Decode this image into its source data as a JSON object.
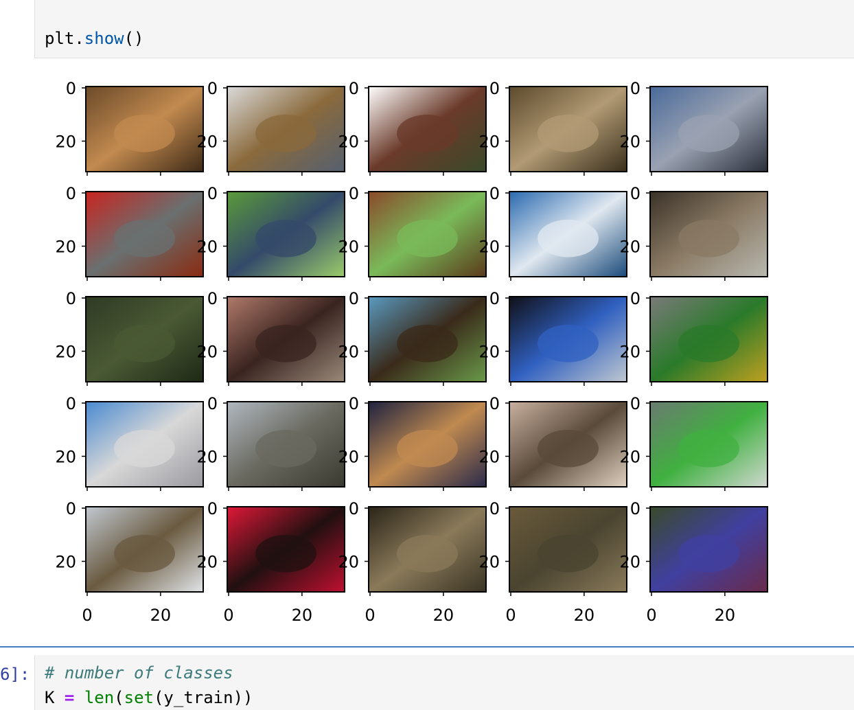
{
  "top_cell": {
    "code_obj": "plt.",
    "code_fn": "show",
    "code_rest": "()"
  },
  "figure": {
    "ytick_0": "0",
    "ytick_20": "20",
    "xtick_0": "0",
    "xtick_20": "20",
    "images": [
      {
        "name": "frog-image",
        "c1": "#6b4a2a",
        "c2": "#c28a4f",
        "c3": "#3e2a17"
      },
      {
        "name": "truck-image",
        "c1": "#dadada",
        "c2": "#8a6a3c",
        "c3": "#556070"
      },
      {
        "name": "truck-image",
        "c1": "#ffffff",
        "c2": "#6a3a2a",
        "c3": "#3a4a2a"
      },
      {
        "name": "deer-image",
        "c1": "#5c4a2c",
        "c2": "#b19a74",
        "c3": "#3a2f1c"
      },
      {
        "name": "automobile-image",
        "c1": "#4a6a9a",
        "c2": "#9aa2b2",
        "c3": "#2a2f3a"
      },
      {
        "name": "automobile-image",
        "c1": "#c9241f",
        "c2": "#6a7070",
        "c3": "#8a2a10"
      },
      {
        "name": "bird-image",
        "c1": "#5a9a3a",
        "c2": "#344a6a",
        "c3": "#9acb6a"
      },
      {
        "name": "horse-image",
        "c1": "#8a4a2a",
        "c2": "#7aba5a",
        "c3": "#5a3a1a"
      },
      {
        "name": "ship-image",
        "c1": "#2a6ab0",
        "c2": "#e0e8f0",
        "c3": "#1a4a7a"
      },
      {
        "name": "cat-image",
        "c1": "#3a3228",
        "c2": "#8a7a64",
        "c3": "#b8b8b0"
      },
      {
        "name": "deer-image",
        "c1": "#2f3a24",
        "c2": "#4a5a34",
        "c3": "#1e2816"
      },
      {
        "name": "horse-image",
        "c1": "#b07a6a",
        "c2": "#3a2420",
        "c3": "#9a8a7a"
      },
      {
        "name": "horse-image",
        "c1": "#5a9ac0",
        "c2": "#3a2a1a",
        "c3": "#6a9a4a"
      },
      {
        "name": "bird-image",
        "c1": "#101018",
        "c2": "#3060c0",
        "c3": "#c0c8d0"
      },
      {
        "name": "truck-image",
        "c1": "#7a7a7a",
        "c2": "#2a7a2a",
        "c3": "#c0a020"
      },
      {
        "name": "truck-image",
        "c1": "#4a8ad0",
        "c2": "#d8d8d8",
        "c3": "#9a9aa0"
      },
      {
        "name": "truck-image",
        "c1": "#b0b8c0",
        "c2": "#6a6a60",
        "c3": "#3a3a30"
      },
      {
        "name": "cat-image",
        "c1": "#1e2240",
        "c2": "#c08a50",
        "c3": "#2a2a4a"
      },
      {
        "name": "bird-image",
        "c1": "#c8b0a0",
        "c2": "#5a4a3a",
        "c3": "#e0d0c0"
      },
      {
        "name": "frog-image",
        "c1": "#6a7a70",
        "c2": "#40b040",
        "c3": "#d0d8d0"
      },
      {
        "name": "deer-image",
        "c1": "#c0c8d0",
        "c2": "#6a5a40",
        "c3": "#e0e4e8"
      },
      {
        "name": "frog-image",
        "c1": "#e01838",
        "c2": "#201010",
        "c3": "#c01030"
      },
      {
        "name": "frog-image",
        "c1": "#2a2418",
        "c2": "#8a7a5a",
        "c3": "#3a3424"
      },
      {
        "name": "frog-image",
        "c1": "#6a5a3a",
        "c2": "#4a4430",
        "c3": "#8a7a5a"
      },
      {
        "name": "bird-image",
        "c1": "#3a4a2a",
        "c2": "#4040a0",
        "c3": "#6a2a4a"
      }
    ]
  },
  "bottom_cell": {
    "prompt": "6]:",
    "comment": "# number of classes",
    "line2_var": "K ",
    "line2_op": "=",
    "line2_sp": " ",
    "line2_fn1": "len",
    "line2_p1": "(",
    "line2_fn2": "set",
    "line2_rest": "(y_train))"
  }
}
